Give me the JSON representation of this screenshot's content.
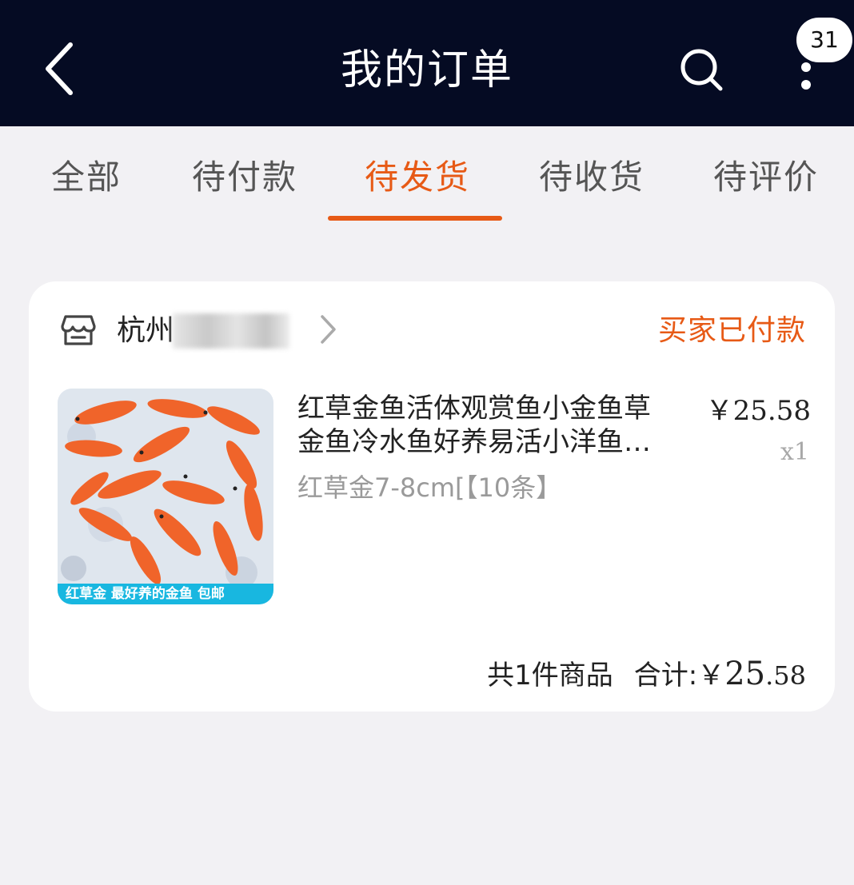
{
  "header": {
    "title": "我的订单",
    "notification_badge": "31",
    "icons": {
      "back": "back-arrow-icon",
      "search": "search-icon",
      "more": "more-vertical-icon"
    }
  },
  "tabs": [
    {
      "label": "全部",
      "active": false
    },
    {
      "label": "待付款",
      "active": false
    },
    {
      "label": "待发货",
      "active": true
    },
    {
      "label": "待收货",
      "active": false
    },
    {
      "label": "待评价",
      "active": false
    }
  ],
  "order": {
    "shop_name": "杭州",
    "status": "买家已付款",
    "product": {
      "image_caption": "红草金  最好养的金鱼  包邮",
      "title_line1": "红草金鱼活体观赏鱼小金鱼草",
      "title_line2": "金鱼冷水鱼好养易活小洋鱼…",
      "spec": "红草金7-8cm[【10条】",
      "price": "￥25.58",
      "quantity": "x1"
    },
    "summary": {
      "count_text": "共1件商品",
      "total_label": "合计:",
      "currency": "￥",
      "total_integer": "25",
      "total_decimal": ".58"
    }
  },
  "colors": {
    "header_bg": "#050b23",
    "accent": "#e75a16",
    "page_bg": "#f2f1f4",
    "card_bg": "#ffffff",
    "caption_bg": "#18b7e0"
  }
}
